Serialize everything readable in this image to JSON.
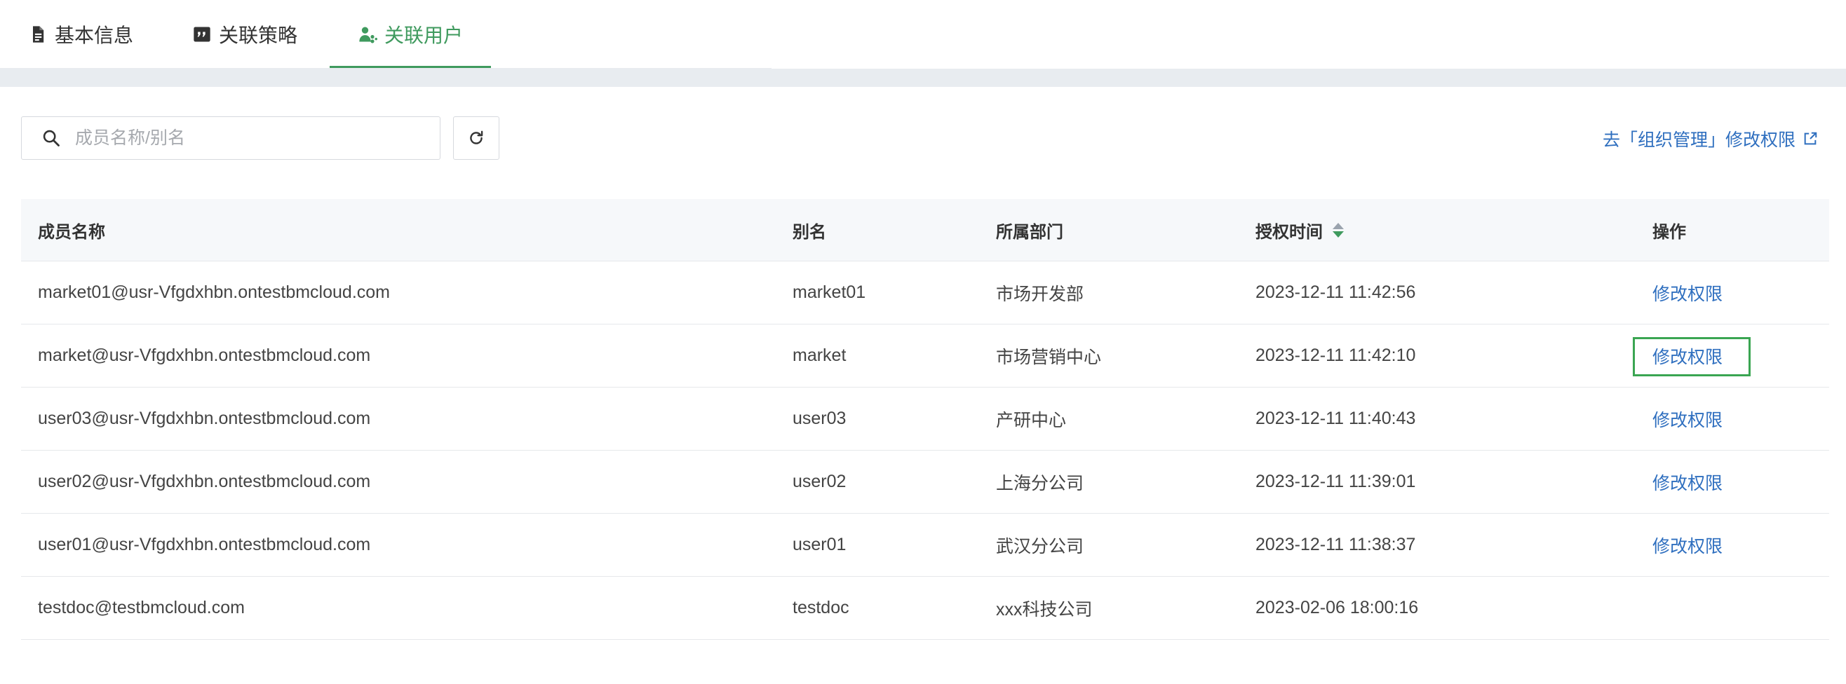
{
  "tabs": [
    {
      "label": "基本信息",
      "icon": "document-icon",
      "active": false
    },
    {
      "label": "关联策略",
      "icon": "quote-icon",
      "active": false
    },
    {
      "label": "关联用户",
      "icon": "users-icon",
      "active": true
    }
  ],
  "toolbar": {
    "search_placeholder": "成员名称/别名",
    "search_value": "",
    "refresh_icon": "refresh-icon",
    "org_link_label": "去「组织管理」修改权限",
    "org_link_icon": "external-link-icon"
  },
  "table": {
    "columns": [
      "成员名称",
      "别名",
      "所属部门",
      "授权时间",
      "操作"
    ],
    "sort_column": "授权时间",
    "rows": [
      {
        "name": "market01@usr-Vfgdxhbn.ontestbmcloud.com",
        "alias": "market01",
        "dept": "市场开发部",
        "time": "2023-12-11 11:42:56",
        "action": "修改权限"
      },
      {
        "name": "market@usr-Vfgdxhbn.ontestbmcloud.com",
        "alias": "market",
        "dept": "市场营销中心",
        "time": "2023-12-11 11:42:10",
        "action": "修改权限"
      },
      {
        "name": "user03@usr-Vfgdxhbn.ontestbmcloud.com",
        "alias": "user03",
        "dept": "产研中心",
        "time": "2023-12-11 11:40:43",
        "action": "修改权限"
      },
      {
        "name": "user02@usr-Vfgdxhbn.ontestbmcloud.com",
        "alias": "user02",
        "dept": "上海分公司",
        "time": "2023-12-11 11:39:01",
        "action": "修改权限"
      },
      {
        "name": "user01@usr-Vfgdxhbn.ontestbmcloud.com",
        "alias": "user01",
        "dept": "武汉分公司",
        "time": "2023-12-11 11:38:37",
        "action": "修改权限"
      },
      {
        "name": "testdoc@testbmcloud.com",
        "alias": "testdoc",
        "dept": "xxx科技公司",
        "time": "2023-02-06 18:00:16",
        "action": ""
      }
    ]
  },
  "colors": {
    "accent": "#3f9a5e",
    "link": "#2f6fbf",
    "focus": "#3aa552"
  }
}
